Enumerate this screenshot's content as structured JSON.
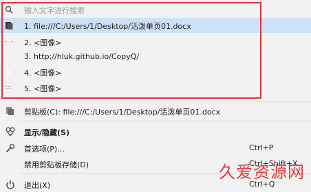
{
  "search": {
    "placeholder": "输入文字进行搜索"
  },
  "history": [
    {
      "label": "1. file:///C:/Users/1/Desktop/活泼单页01.docx",
      "selected": true
    },
    {
      "label": "2. <图像>"
    },
    {
      "label": "3. http://hluk.github.io/CopyQ/"
    },
    {
      "label": "4. <图像>"
    },
    {
      "label": "5. <图像>"
    }
  ],
  "clipboard": {
    "label": "剪贴板(C): file:///C:/Users/1/Desktop/活泼单页01.docx"
  },
  "actions": {
    "show_hide": {
      "label": "显示/隐藏(S)"
    },
    "preferences": {
      "label": "首选项(P)...",
      "shortcut": "Ctrl+P"
    },
    "disable_storing": {
      "label": "禁用剪贴板存储(D)",
      "shortcut": "Ctrl+Shift+X"
    },
    "exit": {
      "label": "退出(X)",
      "shortcut": "Ctrl+Q"
    }
  },
  "watermark": {
    "text": "久爱资源网"
  },
  "colors": {
    "selection": "#cde2f7",
    "highlight_frame": "#e0303a",
    "watermark": "#e4393c"
  }
}
